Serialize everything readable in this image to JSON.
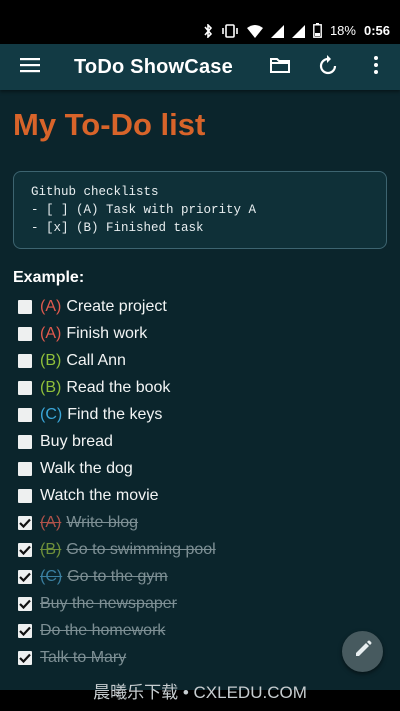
{
  "status_bar": {
    "battery": "18%",
    "time": "0:56",
    "icons": [
      "bluetooth-icon",
      "vibrate-icon",
      "wifi-icon",
      "signal-icon",
      "signal-icon",
      "battery-icon"
    ]
  },
  "app_bar": {
    "title": "ToDo ShowCase",
    "icons": [
      "menu-icon",
      "folder-icon",
      "refresh-icon",
      "more-vert-icon"
    ]
  },
  "page": {
    "heading": "My To-Do list",
    "code_lines": [
      "Github checklists",
      "- [ ] (A) Task with priority A",
      "- [x] (B) Finished task"
    ],
    "example_label": "Example:"
  },
  "tasks": [
    {
      "priority": "(A)",
      "priority_color": "#e05a4e",
      "text": "Create project",
      "done": false
    },
    {
      "priority": "(A)",
      "priority_color": "#e05a4e",
      "text": "Finish work",
      "done": false
    },
    {
      "priority": "(B)",
      "priority_color": "#8fbf3a",
      "text": "Call Ann",
      "done": false
    },
    {
      "priority": "(B)",
      "priority_color": "#8fbf3a",
      "text": "Read the book",
      "done": false
    },
    {
      "priority": "(C)",
      "priority_color": "#3aa6d8",
      "text": "Find the keys",
      "done": false
    },
    {
      "priority": "",
      "priority_color": "",
      "text": "Buy bread",
      "done": false
    },
    {
      "priority": "",
      "priority_color": "",
      "text": "Walk the dog",
      "done": false
    },
    {
      "priority": "",
      "priority_color": "",
      "text": "Watch the movie",
      "done": false
    },
    {
      "priority": "(A)",
      "priority_color": "#b0524a",
      "text": "Write blog",
      "done": true
    },
    {
      "priority": "(B)",
      "priority_color": "#6e8f3a",
      "text": "Go to swimming pool",
      "done": true
    },
    {
      "priority": "(C)",
      "priority_color": "#3a7fa0",
      "text": "Go to the gym",
      "done": true
    },
    {
      "priority": "",
      "priority_color": "",
      "text": "Buy the newspaper",
      "done": true
    },
    {
      "priority": "",
      "priority_color": "",
      "text": "Do the homework",
      "done": true
    },
    {
      "priority": "",
      "priority_color": "",
      "text": "Talk to Mary",
      "done": true
    }
  ],
  "fab": {
    "icon": "edit-pencil-icon"
  },
  "watermark": "晨曦乐下载 • CXLEDU.COM",
  "colors": {
    "background": "#0b252c",
    "app_bar": "#123a44",
    "heading": "#d8642a",
    "done_text": "#7d8f94"
  }
}
